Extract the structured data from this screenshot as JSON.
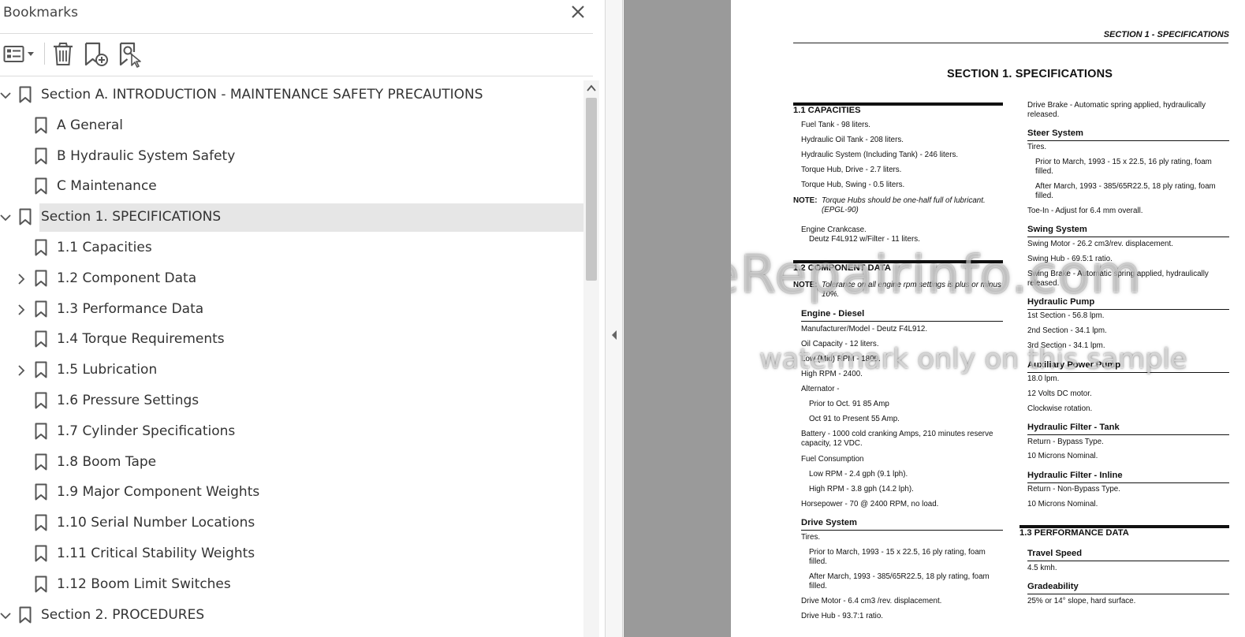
{
  "bookmarks_panel": {
    "title": "Bookmarks",
    "toolbar": {
      "options_icon": "list-options-icon",
      "delete_icon": "trash-icon",
      "new_bookmark_icon": "add-bookmark-icon",
      "find_bookmark_icon": "find-bookmark-icon"
    },
    "close_icon": "close-icon",
    "items": [
      {
        "label": "Section A. INTRODUCTION - MAINTENANCE SAFETY PRECAUTIONS",
        "level": 0,
        "expander": "expanded"
      },
      {
        "label": "A General",
        "level": 1,
        "expander": "none"
      },
      {
        "label": "B Hydraulic System Safety",
        "level": 1,
        "expander": "none"
      },
      {
        "label": "C Maintenance",
        "level": 1,
        "expander": "none"
      },
      {
        "label": "Section 1. SPECIFICATIONS",
        "level": 0,
        "expander": "expanded",
        "selected": true
      },
      {
        "label": "1.1 Capacities",
        "level": 1,
        "expander": "none"
      },
      {
        "label": "1.2 Component Data",
        "level": 1,
        "expander": "collapsed"
      },
      {
        "label": "1.3 Performance Data",
        "level": 1,
        "expander": "collapsed"
      },
      {
        "label": "1.4 Torque Requirements",
        "level": 1,
        "expander": "none"
      },
      {
        "label": "1.5 Lubrication",
        "level": 1,
        "expander": "collapsed"
      },
      {
        "label": "1.6 Pressure Settings",
        "level": 1,
        "expander": "none"
      },
      {
        "label": "1.7 Cylinder Specifications",
        "level": 1,
        "expander": "none"
      },
      {
        "label": "1.8 Boom Tape",
        "level": 1,
        "expander": "none"
      },
      {
        "label": "1.9 Major Component Weights",
        "level": 1,
        "expander": "none"
      },
      {
        "label": "1.10 Serial Number Locations",
        "level": 1,
        "expander": "none"
      },
      {
        "label": "1.11 Critical Stability Weights",
        "level": 1,
        "expander": "none"
      },
      {
        "label": "1.12 Boom Limit Switches",
        "level": 1,
        "expander": "none"
      },
      {
        "label": "Section 2. PROCEDURES",
        "level": 0,
        "expander": "expanded"
      }
    ]
  },
  "document": {
    "running_header": "SECTION 1 - SPECIFICATIONS",
    "title": "SECTION 1.  SPECIFICATIONS",
    "watermark_main": "eRepairinfo.com",
    "watermark_sub": "watermark only on this sample",
    "left_column": {
      "capacities": {
        "heading": "1.1    CAPACITIES",
        "lines": [
          "Fuel Tank - 98 liters.",
          "Hydraulic Oil Tank - 208 liters.",
          "Hydraulic System (Including Tank) - 246 liters.",
          "Torque Hub, Drive - 2.7 liters.",
          "Torque Hub, Swing - 0.5 liters."
        ],
        "note_label": "NOTE:",
        "note_text": "Torque Hubs should be one-half full of lubricant. (EPGL-90)",
        "crankcase": "Engine Crankcase.",
        "crankcase_detail": "Deutz F4L912 w/Filter - 11 liters."
      },
      "component_data": {
        "heading": "1.2    COMPONENT DATA",
        "note_label": "NOTE:",
        "note_text": "Tolerance on all engine rpm settings is plus or minus 10%.",
        "engine": {
          "title": "Engine - Diesel",
          "lines": [
            "Manufacturer/Model - Deutz F4L912.",
            "Oil Capacity - 12 liters.",
            "Low (Mid) RPM - 1800.",
            "High RPM - 2400.",
            "Alternator -"
          ],
          "alt_lines": [
            "Prior to Oct. 91 85 Amp",
            "Oct 91 to Present 55 Amp."
          ],
          "battery": "Battery - 1000 cold cranking Amps, 210 minutes reserve capacity, 12 VDC.",
          "fuel": "Fuel Consumption",
          "fuel_lines": [
            "Low RPM - 2.4 gph (9.1 lph).",
            "High RPM - 3.8 gph (14.2 lph)."
          ],
          "horsepower": "Horsepower - 70 @ 2400 RPM, no load."
        },
        "drive": {
          "title": "Drive System",
          "tires": "Tires.",
          "tire_a": "Prior to March, 1993 - 15 x 22.5, 16 ply rating, foam filled.",
          "tire_b": "After March, 1993 - 385/65R22.5, 18 ply rating, foam filled.",
          "motor": "Drive Motor - 6.4 cm3 /rev. displacement.",
          "hub": "Drive Hub - 93.7:1 ratio."
        }
      }
    },
    "right_column": {
      "drive_brake": "Drive Brake - Automatic spring applied, hydraulically released.",
      "steer": {
        "title": "Steer System",
        "tires": "Tires.",
        "tire_a": "Prior to March, 1993 - 15 x 22.5, 16 ply rating, foam filled.",
        "tire_b": "After March, 1993 - 385/65R22.5, 18 ply rating, foam filled.",
        "toe": "Toe-In - Adjust for 6.4 mm overall."
      },
      "swing": {
        "title": "Swing System",
        "motor": "Swing Motor - 26.2 cm3/rev. displacement.",
        "hub": "Swing Hub - 69.5:1 ratio.",
        "brake": "Swing Brake - Automatic spring applied, hydraulically released."
      },
      "pump": {
        "title": "Hydraulic Pump",
        "lines": [
          "1st Section - 56.8 lpm.",
          "2nd Section - 34.1 lpm.",
          "3rd Section - 34.1 lpm."
        ]
      },
      "aux": {
        "title": "Auxiliary Power Pump",
        "lines": [
          "18.0 lpm.",
          "12 Volts DC motor.",
          "Clockwise rotation."
        ]
      },
      "filter_tank": {
        "title": "Hydraulic Filter - Tank",
        "lines": [
          "Return - Bypass Type.",
          "10 Microns Nominal."
        ]
      },
      "filter_inline": {
        "title": "Hydraulic Filter - Inline",
        "lines": [
          "Return - Non-Bypass Type.",
          "10 Microns Nominal."
        ]
      },
      "performance": {
        "heading": "1.3    PERFORMANCE DATA",
        "travel_title": "Travel Speed",
        "travel": "4.5 kmh.",
        "grade_title": "Gradeability",
        "grade": "25% or 14° slope, hard surface."
      }
    }
  }
}
